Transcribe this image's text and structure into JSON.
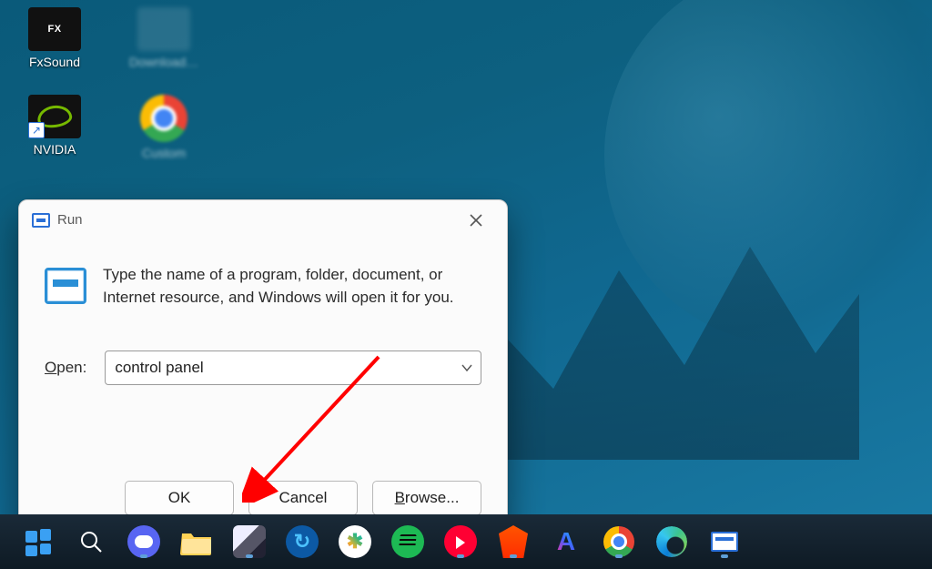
{
  "desktop": {
    "icons": [
      {
        "id": "fxsound",
        "label": "FxSound"
      },
      {
        "id": "nvidia",
        "label": "NVIDIA"
      }
    ]
  },
  "run_dialog": {
    "title": "Run",
    "description": "Type the name of a program, folder, document, or Internet resource, and Windows will open it for you.",
    "open_label_pre": "O",
    "open_label_u": "pen:",
    "open_value": "control panel",
    "buttons": {
      "ok": "OK",
      "cancel": "Cancel",
      "browse_u": "B",
      "browse_rest": "rowse..."
    }
  },
  "taskbar": {
    "items": [
      "start",
      "search",
      "discord",
      "explorer",
      "avatar",
      "sync",
      "slack",
      "spotify",
      "youtube-music",
      "brave",
      "arc",
      "chrome",
      "edge",
      "run"
    ]
  }
}
